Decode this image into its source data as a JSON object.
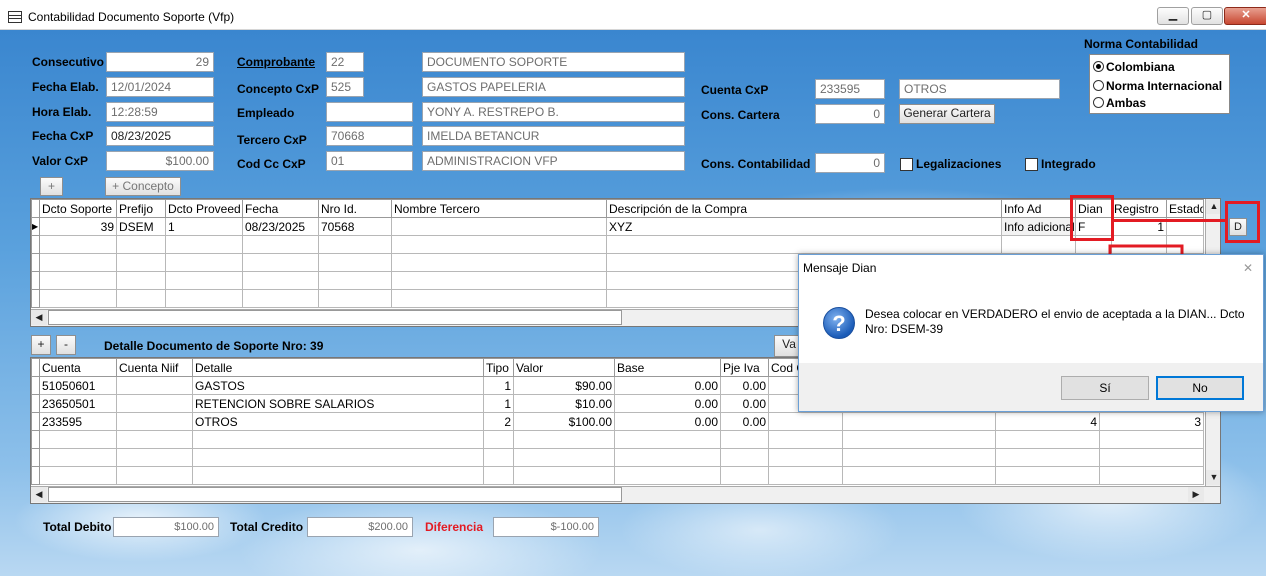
{
  "window": {
    "title": "Contabilidad Documento Soporte (Vfp)",
    "min": "▁",
    "max": "▢",
    "close": "✕"
  },
  "header": {
    "consecutivo": {
      "label": "Consecutivo",
      "value": "29"
    },
    "fecha_elab": {
      "label": "Fecha Elab.",
      "value": "12/01/2024"
    },
    "hora_elab": {
      "label": "Hora Elab.",
      "value": "12:28:59"
    },
    "fecha_cxp": {
      "label": "Fecha CxP",
      "value": "08/23/2025"
    },
    "valor_cxp": {
      "label": "Valor CxP",
      "value": "$100.00"
    },
    "comprobante": {
      "label": "Comprobante",
      "code": "22",
      "name": "DOCUMENTO SOPORTE"
    },
    "concepto_cxp": {
      "label": "Concepto CxP",
      "code": "525",
      "name": "GASTOS PAPELERIA"
    },
    "empleado": {
      "label": "Empleado",
      "code": "",
      "name": "YONY A. RESTREPO B."
    },
    "tercero_cxp": {
      "label": "Tercero CxP",
      "code": "70668",
      "name": "IMELDA BETANCUR"
    },
    "cod_cc_cxp": {
      "label": "Cod Cc CxP",
      "code": "01",
      "name": "ADMINISTRACION VFP"
    },
    "cuenta_cxp": {
      "label": "Cuenta CxP",
      "code": "233595",
      "name": "OTROS"
    },
    "cons_cartera": {
      "label": "Cons. Cartera",
      "value": "0"
    },
    "generar_cartera": "Generar Cartera",
    "cons_contabilidad": {
      "label": "Cons. Contabilidad",
      "value": "0"
    },
    "legalizaciones": "Legalizaciones",
    "integrado": "Integrado"
  },
  "norma": {
    "title": "Norma Contabilidad",
    "options": [
      "Colombiana",
      "Norma Internacional",
      "Ambas"
    ],
    "selected": "Colombiana"
  },
  "top_toolbar": {
    "plus": "+",
    "concepto": "+ Concepto"
  },
  "top_grid": {
    "columns": [
      "Dcto Soporte",
      "Prefijo",
      "Dcto Proveed",
      "Fecha",
      "Nro Id.",
      "Nombre Tercero",
      "Descripción de la Compra",
      "Info Ad",
      "Dian",
      "Registro",
      "Estado"
    ],
    "rows": [
      [
        "39",
        "DSEM",
        "1",
        "08/23/2025",
        "70568",
        "",
        "XYZ",
        "Info adicional",
        "F",
        "1",
        ""
      ]
    ],
    "d_button": "D"
  },
  "detail": {
    "plus": "+",
    "minus": "-",
    "title": "Detalle Documento de Soporte Nro: 39",
    "hidden_btn": "Va",
    "columns": [
      "Cuenta",
      "Cuenta Niif",
      "Detalle",
      "Tipo",
      "Valor",
      "Base",
      "Pje Iva",
      "Cod C"
    ],
    "rows": [
      [
        "51050601",
        "",
        "GASTOS",
        "1",
        "$90.00",
        "0.00",
        "0.00",
        "",
        "",
        "",
        ""
      ],
      [
        "23650501",
        "",
        "RETENCION SOBRE SALARIOS",
        "1",
        "$10.00",
        "0.00",
        "0.00",
        "",
        "",
        "",
        ""
      ],
      [
        "233595",
        "",
        "OTROS",
        "2",
        "$100.00",
        "0.00",
        "0.00",
        "",
        "",
        "4",
        "3"
      ]
    ]
  },
  "totals": {
    "debito_label": "Total Debito",
    "debito": "$100.00",
    "credito_label": "Total Credito",
    "credito": "$200.00",
    "diferencia_label": "Diferencia",
    "diferencia": "$-100.00",
    "diferencia_color": "#e31b23"
  },
  "dialog": {
    "title": "Mensaje Dian",
    "close": "✕",
    "icon": "?",
    "line1": "Desea colocar en VERDADERO el envio de aceptada a la DIAN... Dcto",
    "line2": "Nro: DSEM-39",
    "yes": "Sí",
    "no": "No"
  },
  "scroll": {
    "left": "◀",
    "right": "▶",
    "up": "▲",
    "down": "▼"
  },
  "colors": {
    "highlight": "#e31b23",
    "sky": "#5aa1dd"
  }
}
